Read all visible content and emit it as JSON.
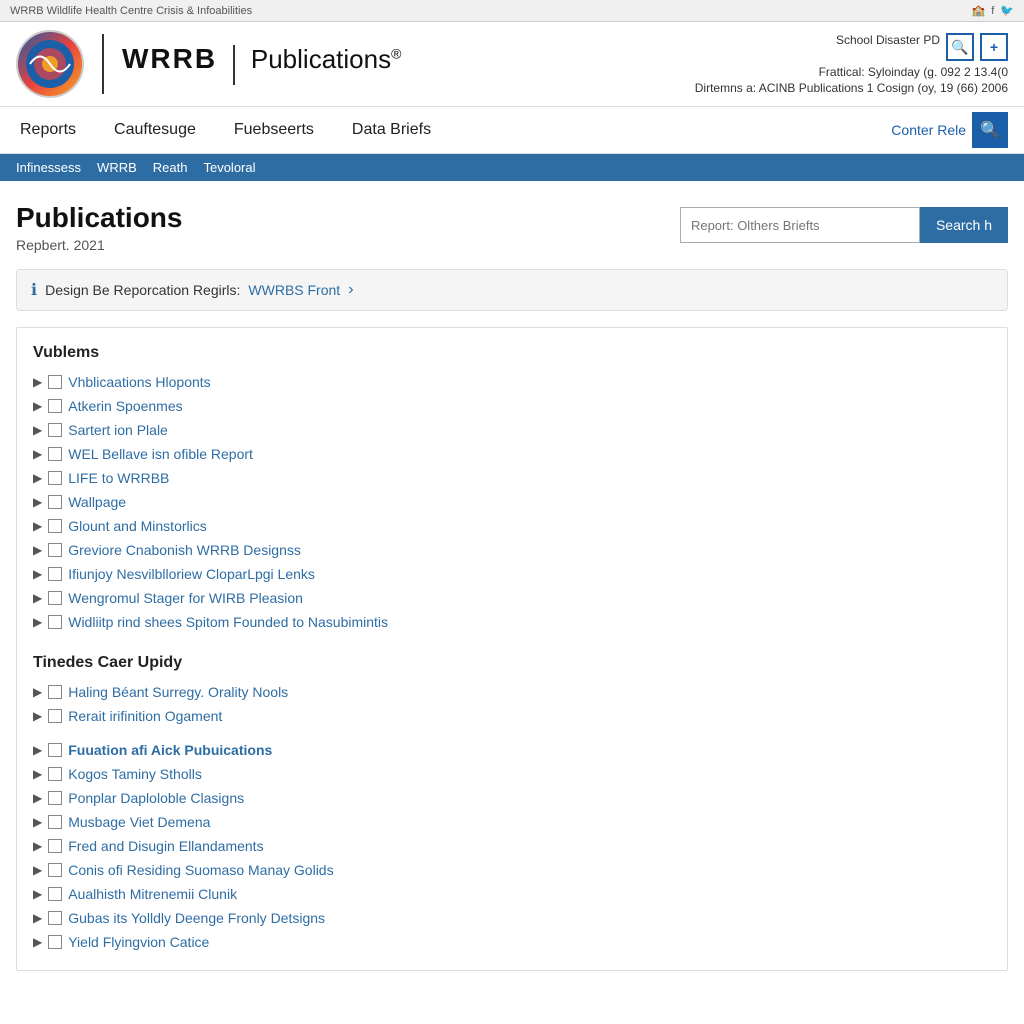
{
  "topbar": {
    "left_text": "WRRB Wildlife Health Centre Crisis & Infoabilities",
    "right_items": [
      "school",
      "fb",
      "tw"
    ]
  },
  "header": {
    "logo_text": "WRRB",
    "publications_title": "Publications",
    "reg_symbol": "®",
    "school_info": "School Disaster PD",
    "frattical_line": "Frattical: Syloinday (g. 092 2 13.4(0",
    "dirtemns_line": "Dirtemns a: ACINB Publications 1 Cosign (oy, 19 (66) 2006",
    "icon_search": "🔍",
    "icon_plus": "+"
  },
  "nav": {
    "items": [
      "Reports",
      "Cauftesuge",
      "Fuebseerts",
      "Data Briefs"
    ],
    "search_link": "Conter Rele",
    "search_icon": "🔍"
  },
  "breadcrumb": {
    "items": [
      "Infinessess",
      "WRRB",
      "Reath",
      "Tevoloral"
    ]
  },
  "page": {
    "title": "Publications",
    "subtitle": "Repbert. 2021",
    "search_placeholder": "Report: Olthers Briefts",
    "search_button": "Search h"
  },
  "infobox": {
    "text": "Design Be Reporcation Regirls:",
    "link": "WWRBS Front",
    "arrow": "›"
  },
  "volumes_section": {
    "title": "Vublems",
    "items": [
      "Vhblicaations Hloponts",
      "Atkerin Spoenmes",
      "Sartert ion Plale",
      "WEL Bellave isn ofible Report",
      "LIFE to WRRBB",
      "Wallpage",
      "Glount and Minstorlics",
      "Greviore Cnabonish WRRB Designss",
      "Ifiunjoy Nesvilblloriew CloparLpgi Lenks",
      "Wengromul Stager for WIRB Pleasion",
      "Widliitp rind shees Spitom Founded to Nasubimintis"
    ]
  },
  "tinedes_section": {
    "title": "Tinedes Caer Upidy",
    "items": [
      "Haling Béant Surregy. Orality Nools",
      "Rerait irifinition Ogament"
    ]
  },
  "fuuation_section": {
    "title": "Fuuation afi Aick Pubuications",
    "items": [
      "Kogos Taminy Stholls",
      "Ponplar Daploloble Clasigns",
      "Musbage Viet Demena",
      "Fred and Disugin Ellandaments",
      "Conis ofi Residing Suomaso Manay Golids",
      "Aualhisth Mitrenemii Clunik",
      "Gubas its Yolldly Deenge Fronly Detsigns",
      "Yield Flyingvion Catice"
    ]
  }
}
